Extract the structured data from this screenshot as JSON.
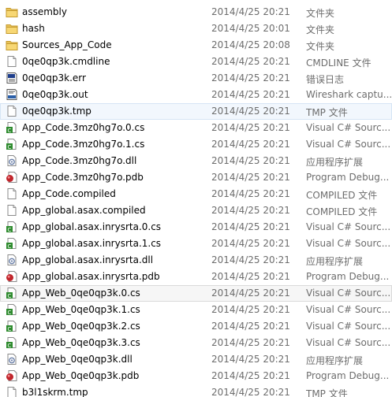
{
  "files": [
    {
      "name": "assembly",
      "date": "2014/4/25 20:21",
      "type": "文件夹",
      "icon": "folder-icon",
      "state": ""
    },
    {
      "name": "hash",
      "date": "2014/4/25 20:01",
      "type": "文件夹",
      "icon": "folder-icon",
      "state": ""
    },
    {
      "name": "Sources_App_Code",
      "date": "2014/4/25 20:08",
      "type": "文件夹",
      "icon": "folder-icon",
      "state": ""
    },
    {
      "name": "0qe0qp3k.cmdline",
      "date": "2014/4/25 20:21",
      "type": "CMDLINE 文件",
      "icon": "file-icon",
      "state": ""
    },
    {
      "name": "0qe0qp3k.err",
      "date": "2014/4/25 20:21",
      "type": "错误日志",
      "icon": "error-log-icon",
      "state": ""
    },
    {
      "name": "0qe0qp3k.out",
      "date": "2014/4/25 20:21",
      "type": "Wireshark captu...",
      "icon": "wireshark-file-icon",
      "state": ""
    },
    {
      "name": "0qe0qp3k.tmp",
      "date": "2014/4/25 20:21",
      "type": "TMP 文件",
      "icon": "file-icon",
      "state": "hover"
    },
    {
      "name": "App_Code.3mz0hg7o.0.cs",
      "date": "2014/4/25 20:21",
      "type": "Visual C# Sourc...",
      "icon": "csharp-file-icon",
      "state": ""
    },
    {
      "name": "App_Code.3mz0hg7o.1.cs",
      "date": "2014/4/25 20:21",
      "type": "Visual C# Sourc...",
      "icon": "csharp-file-icon",
      "state": ""
    },
    {
      "name": "App_Code.3mz0hg7o.dll",
      "date": "2014/4/25 20:21",
      "type": "应用程序扩展",
      "icon": "dll-file-icon",
      "state": ""
    },
    {
      "name": "App_Code.3mz0hg7o.pdb",
      "date": "2014/4/25 20:21",
      "type": "Program Debug...",
      "icon": "pdb-file-icon",
      "state": ""
    },
    {
      "name": "App_Code.compiled",
      "date": "2014/4/25 20:21",
      "type": "COMPILED 文件",
      "icon": "file-icon",
      "state": ""
    },
    {
      "name": "App_global.asax.compiled",
      "date": "2014/4/25 20:21",
      "type": "COMPILED 文件",
      "icon": "file-icon",
      "state": ""
    },
    {
      "name": "App_global.asax.inrysrta.0.cs",
      "date": "2014/4/25 20:21",
      "type": "Visual C# Sourc...",
      "icon": "csharp-file-icon",
      "state": ""
    },
    {
      "name": "App_global.asax.inrysrta.1.cs",
      "date": "2014/4/25 20:21",
      "type": "Visual C# Sourc...",
      "icon": "csharp-file-icon",
      "state": ""
    },
    {
      "name": "App_global.asax.inrysrta.dll",
      "date": "2014/4/25 20:21",
      "type": "应用程序扩展",
      "icon": "dll-file-icon",
      "state": ""
    },
    {
      "name": "App_global.asax.inrysrta.pdb",
      "date": "2014/4/25 20:21",
      "type": "Program Debug...",
      "icon": "pdb-file-icon",
      "state": ""
    },
    {
      "name": "App_Web_0qe0qp3k.0.cs",
      "date": "2014/4/25 20:21",
      "type": "Visual C# Sourc...",
      "icon": "csharp-file-icon",
      "state": "focus"
    },
    {
      "name": "App_Web_0qe0qp3k.1.cs",
      "date": "2014/4/25 20:21",
      "type": "Visual C# Sourc...",
      "icon": "csharp-file-icon",
      "state": ""
    },
    {
      "name": "App_Web_0qe0qp3k.2.cs",
      "date": "2014/4/25 20:21",
      "type": "Visual C# Sourc...",
      "icon": "csharp-file-icon",
      "state": ""
    },
    {
      "name": "App_Web_0qe0qp3k.3.cs",
      "date": "2014/4/25 20:21",
      "type": "Visual C# Sourc...",
      "icon": "csharp-file-icon",
      "state": ""
    },
    {
      "name": "App_Web_0qe0qp3k.dll",
      "date": "2014/4/25 20:21",
      "type": "应用程序扩展",
      "icon": "dll-file-icon",
      "state": ""
    },
    {
      "name": "App_Web_0qe0qp3k.pdb",
      "date": "2014/4/25 20:21",
      "type": "Program Debug...",
      "icon": "pdb-file-icon",
      "state": ""
    },
    {
      "name": "b3l1skrm.tmp",
      "date": "2014/4/25 20:21",
      "type": "TMP 文件",
      "icon": "file-icon",
      "state": ""
    }
  ]
}
